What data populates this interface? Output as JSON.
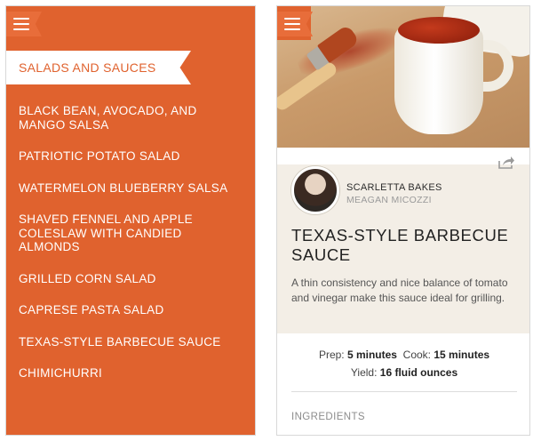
{
  "left_screen": {
    "section_title": "SALADS AND SAUCES",
    "menu_icon": "hamburger-menu-icon",
    "items": [
      {
        "label": "BLACK BEAN, AVOCADO, AND MANGO SALSA"
      },
      {
        "label": "PATRIOTIC POTATO SALAD"
      },
      {
        "label": "WATERMELON BLUEBERRY SALSA"
      },
      {
        "label": "SHAVED FENNEL AND APPLE COLESLAW WITH CANDIED ALMONDS"
      },
      {
        "label": "GRILLED CORN SALAD"
      },
      {
        "label": "CAPRESE PASTA SALAD"
      },
      {
        "label": "TEXAS-STYLE BARBECUE SAUCE"
      },
      {
        "label": "CHIMICHURRI"
      }
    ]
  },
  "right_screen": {
    "menu_icon": "hamburger-menu-icon",
    "share_icon": "share-icon",
    "blog_name": "SCARLETTA BAKES",
    "author_name": "MEAGAN MICOZZI",
    "recipe_title": "TEXAS-STYLE BARBECUE SAUCE",
    "description": "A thin consistency and nice balance of tomato and vinegar make this sauce ideal for grilling.",
    "prep_label": "Prep:",
    "prep_value": "5 minutes",
    "cook_label": "Cook:",
    "cook_value": "15 minutes",
    "yield_label": "Yield:",
    "yield_value": "16 fluid ounces",
    "ingredients_heading": "INGREDIENTS"
  },
  "colors": {
    "accent": "#e0622e",
    "author_band": "#f3eee6"
  }
}
